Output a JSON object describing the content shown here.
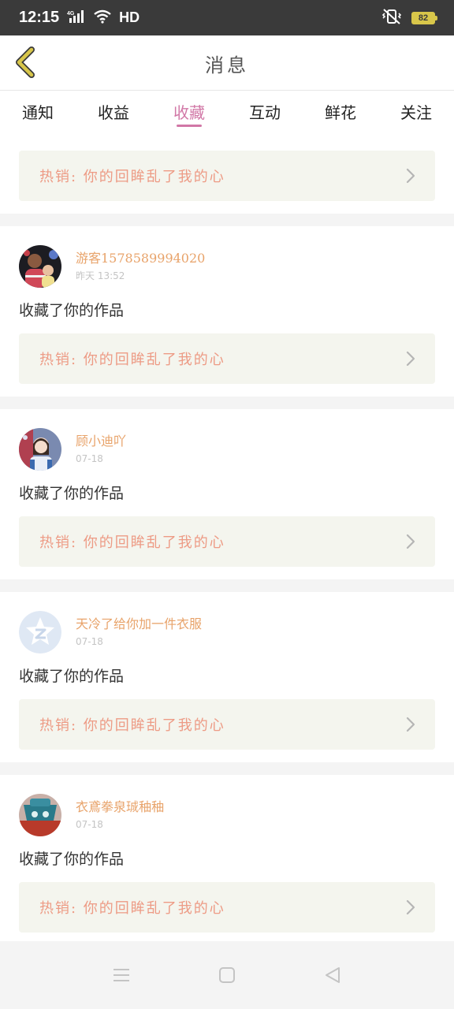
{
  "status_bar": {
    "time": "12:15",
    "network": "4G",
    "hd": "HD",
    "battery": "82",
    "icons": [
      "signal-icon",
      "wifi-icon",
      "vibrate-icon",
      "battery-icon"
    ]
  },
  "header": {
    "title": "消息"
  },
  "tabs": [
    {
      "label": "通知"
    },
    {
      "label": "收益"
    },
    {
      "label": "收藏"
    },
    {
      "label": "互动"
    },
    {
      "label": "鲜花"
    },
    {
      "label": "关注"
    }
  ],
  "active_tab": "收藏",
  "first_card": {
    "promo": "热销: 你的回眸乱了我的心"
  },
  "messages": [
    {
      "name": "游客1578589994020",
      "time": "昨天 13:52",
      "action": "收藏了你的作品",
      "promo": "热销: 你的回眸乱了我的心"
    },
    {
      "name": "顾小迪吖",
      "time": "07-18",
      "action": "收藏了你的作品",
      "promo": "热销: 你的回眸乱了我的心"
    },
    {
      "name": "天冷了给你加一件衣服",
      "time": "07-18",
      "action": "收藏了你的作品",
      "promo": "热销: 你的回眸乱了我的心"
    },
    {
      "name": "衣鳶拳泉珹秞秞",
      "time": "07-18",
      "action": "收藏了你的作品",
      "promo": "热销: 你的回眸乱了我的心"
    }
  ],
  "colors": {
    "accent": "#d177a6",
    "name": "#e8a36a",
    "promo_text": "#ed9b85",
    "promo_bg": "#f4f5ee",
    "back_icon": "#d8c64a"
  },
  "nav": [
    "menu-icon",
    "home-icon",
    "back-triangle-icon"
  ]
}
